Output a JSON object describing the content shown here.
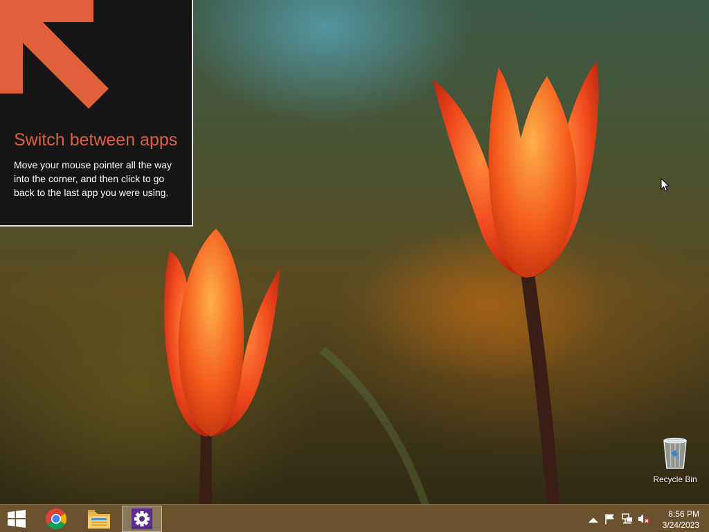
{
  "tip": {
    "title": "Switch between apps",
    "body": "Move your mouse pointer all the way into the corner, and then click to go back to the last app you were using."
  },
  "desktop_icons": [
    {
      "label": "Recycle Bin",
      "icon": "recycle-bin-icon"
    }
  ],
  "taskbar": {
    "start_icon": "windows-logo-icon",
    "pinned": [
      {
        "app": "Google Chrome",
        "icon": "chrome-icon"
      },
      {
        "app": "File Explorer",
        "icon": "folder-icon"
      },
      {
        "app": "PC settings",
        "icon": "gear-icon",
        "active": true
      }
    ],
    "tray": {
      "icons": [
        "chevron-up-icon",
        "flag-icon",
        "network-icon",
        "volume-muted-icon"
      ],
      "time": "8:56 PM",
      "date": "3/24/2023"
    }
  },
  "colors": {
    "accent": "#e15f3b",
    "tip_background": "#151515",
    "settings_tile": "#5c2d91"
  }
}
